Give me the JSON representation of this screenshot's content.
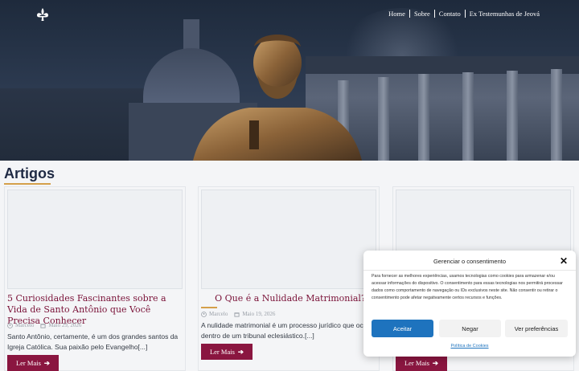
{
  "nav": {
    "items": [
      {
        "label": "Home"
      },
      {
        "label": "Sobre"
      },
      {
        "label": "Contato"
      },
      {
        "label": "Ex Testemunhas de Jeová"
      }
    ]
  },
  "section": {
    "title": "Artigos"
  },
  "articles": [
    {
      "title": "5 Curiosidades Fascinantes sobre a Vida de Santo Antônio que Você Precisa Conhecer",
      "author": "Marcelo",
      "date": "Maio 29, 2026",
      "excerpt": "Santo Antônio, certamente, é um dos grandes santos da Igreja Católica. Sua paixão pelo Evangelho[...]",
      "button": "Ler Mais"
    },
    {
      "title": "O Que é a Nulidade Matrimonial?",
      "author": "Marcelo",
      "date": "Maio 19, 2026",
      "excerpt": "A nulidade matrimonial é um processo jurídico que ocorre dentro de um tribunal eclesiástico.[...]",
      "button": "Ler Mais"
    },
    {
      "title": "",
      "author": "",
      "date": "",
      "excerpt": "",
      "button": "Ler Mais"
    }
  ],
  "consent": {
    "title": "Gerenciar o consentimento",
    "body": "Para fornecer as melhores experiências, usamos tecnologias como cookies para armazenar e/ou acessar informações do dispositivo. O consentimento para essas tecnologias nos permitirá processar dados como comportamento de navegação ou IDs exclusivos neste site. Não consentir ou retirar o consentimento pode afetar negativamente certos recursos e funções.",
    "accept": "Aceitar",
    "deny": "Negar",
    "preferences": "Ver preferências",
    "policy": "Política de Cookies"
  },
  "colors": {
    "accent": "#8a1640",
    "gold": "#d4a04a",
    "primary_blue": "#1e73be"
  }
}
